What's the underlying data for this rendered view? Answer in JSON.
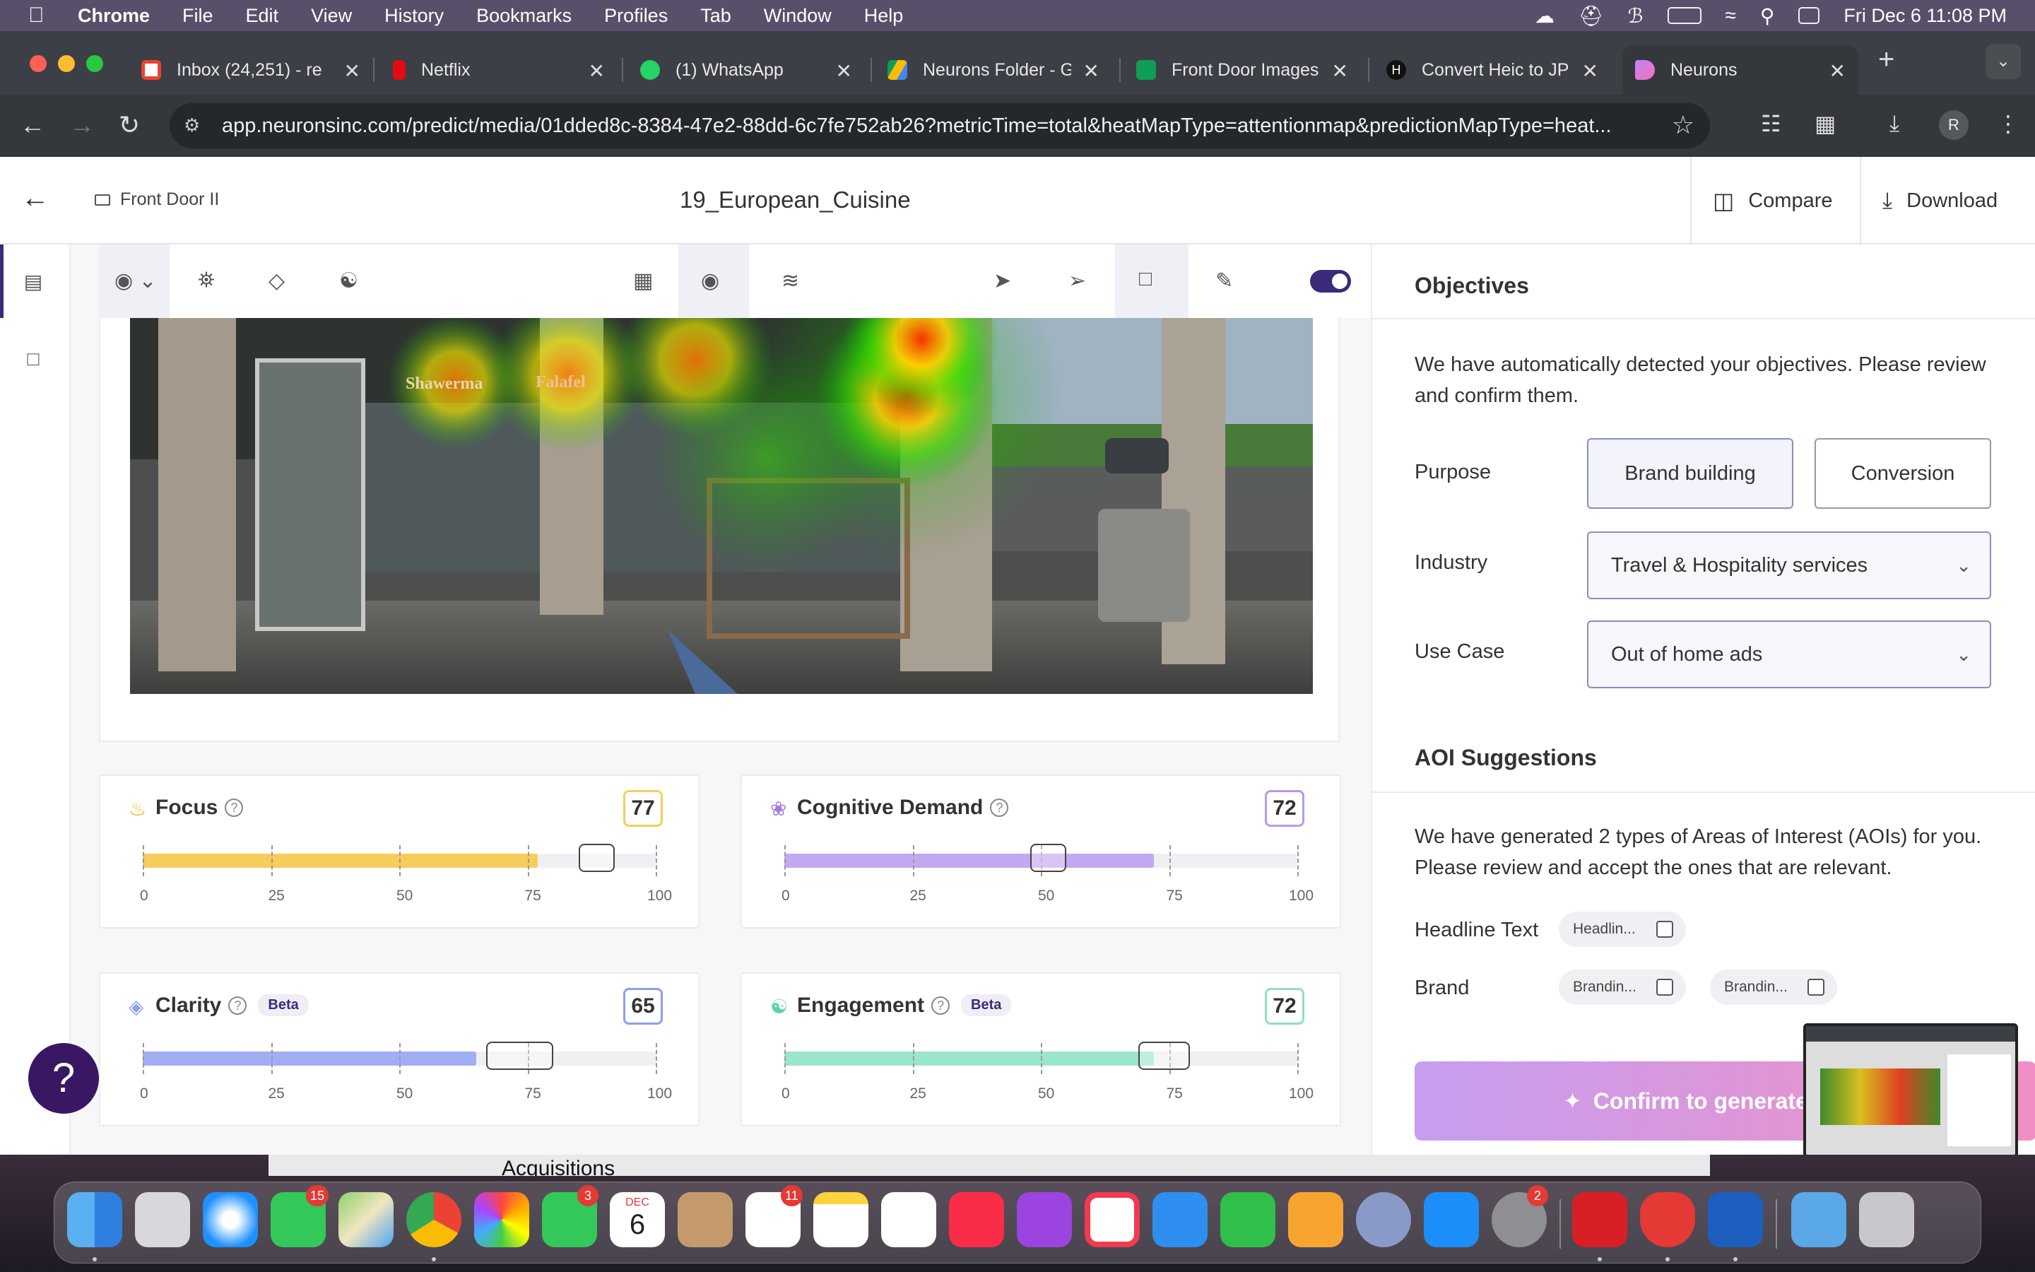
{
  "menubar": {
    "app": "Chrome",
    "items": [
      "File",
      "Edit",
      "View",
      "History",
      "Bookmarks",
      "Profiles",
      "Tab",
      "Window",
      "Help"
    ],
    "datetime": "Fri Dec 6  11:08 PM"
  },
  "tabs": [
    {
      "label": "Inbox (24,251) - re",
      "icon": "gmail-icon",
      "color": "#ea4335"
    },
    {
      "label": "Netflix",
      "icon": "netflix-icon",
      "color": "#e50914"
    },
    {
      "label": "(1) WhatsApp",
      "icon": "whatsapp-icon",
      "color": "#25d366"
    },
    {
      "label": "Neurons Folder - G",
      "icon": "drive-icon",
      "color": "#fbbc04"
    },
    {
      "label": "Front Door Images",
      "icon": "sheets-icon",
      "color": "#0f9d58"
    },
    {
      "label": "Convert Heic to JP",
      "icon": "heic-icon",
      "color": "#111111"
    },
    {
      "label": "Neurons",
      "icon": "neurons-icon",
      "color": "#c084fc"
    }
  ],
  "address": {
    "url": "app.neuronsinc.com/predict/media/01dded8c-8384-47e2-88dd-6c7fe752ab26?metricTime=total&heatMapType=attentionmap&predictionMapType=heat..."
  },
  "profile_initial": "R",
  "header": {
    "folder": "Front Door II",
    "title": "19_European_Cuisine",
    "compare": "Compare",
    "download": "Download"
  },
  "image": {
    "sign_text_1": "Shawerma",
    "sign_text_2": "Falafel"
  },
  "metrics": {
    "focus": {
      "name": "Focus",
      "score": "77",
      "value": 77,
      "benchmark_low": 85,
      "benchmark_high": 92,
      "color": "#f5cd5b",
      "border": "#f3cf5c",
      "icon": "flame-icon"
    },
    "cognitive": {
      "name": "Cognitive Demand",
      "score": "72",
      "value": 72,
      "benchmark_low": 48,
      "benchmark_high": 55,
      "color": "#c2a8f0",
      "border": "#b79ae8",
      "icon": "brain-icon"
    },
    "clarity": {
      "name": "Clarity",
      "beta": "Beta",
      "score": "65",
      "value": 65,
      "benchmark_low": 67,
      "benchmark_high": 80,
      "color": "#a2aef3",
      "border": "#8f9eee",
      "icon": "diamond-icon"
    },
    "engagement": {
      "name": "Engagement",
      "beta": "Beta",
      "score": "72",
      "value": 72,
      "benchmark_low": 69,
      "benchmark_high": 79,
      "color": "#9ae6c8",
      "border": "#8fe0c0",
      "icon": "people-icon"
    },
    "scale": [
      "0",
      "25",
      "50",
      "75",
      "100"
    ]
  },
  "objectives": {
    "title": "Objectives",
    "description": "We have automatically detected your objectives. Please review and confirm them.",
    "purpose_label": "Purpose",
    "purpose_options": [
      "Brand building",
      "Conversion"
    ],
    "purpose_selected": "Brand building",
    "industry_label": "Industry",
    "industry_value": "Travel & Hospitality services",
    "usecase_label": "Use Case",
    "usecase_value": "Out of home ads"
  },
  "aoi": {
    "title": "AOI Suggestions",
    "description": "We have generated 2 types of Areas of Interest (AOIs) for you. Please review and accept the ones that are relevant.",
    "headline_label": "Headline Text",
    "headline_chip": "Headlin...",
    "brand_label": "Brand",
    "brand_chips": [
      "Brandin...",
      "Brandin..."
    ],
    "confirm": "Confirm to generate in"
  },
  "help_label": "?",
  "behind_window_text": "Acquisitions",
  "dock_badges": {
    "messages": "15",
    "facetime": "3",
    "reminders": "11",
    "settings": "2"
  },
  "calendar": {
    "month": "DEC",
    "day": "6"
  }
}
